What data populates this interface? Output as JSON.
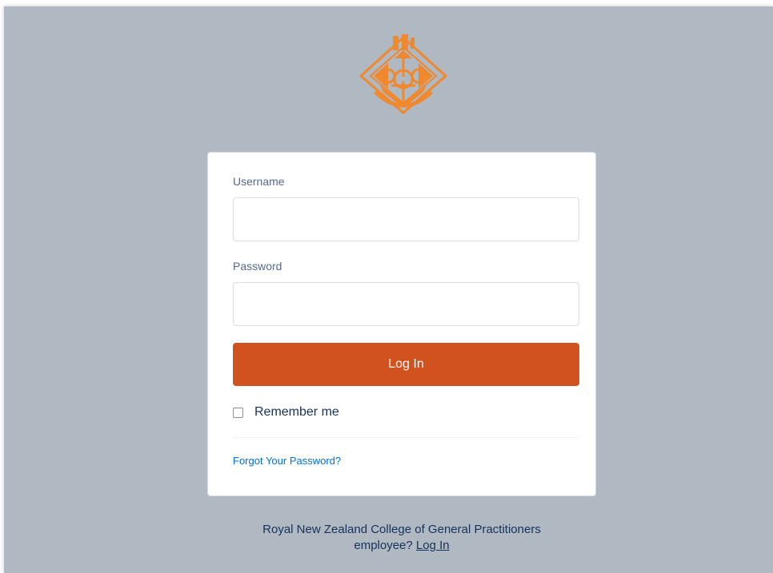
{
  "brand": {
    "logo_icon": "rnzcgp-crest-icon",
    "accent_color": "#d1521f",
    "logo_color": "#f0882d",
    "background_color": "#b0b8c1"
  },
  "form": {
    "username_label": "Username",
    "username_value": "",
    "password_label": "Password",
    "password_value": "",
    "login_button_label": "Log In",
    "remember_me_label": "Remember me",
    "remember_me_checked": false,
    "forgot_password_link": "Forgot Your Password?"
  },
  "footer": {
    "line1": "Royal New Zealand College of General Practitioners",
    "line2_prefix": "employee?",
    "employee_login_link": "Log In"
  }
}
